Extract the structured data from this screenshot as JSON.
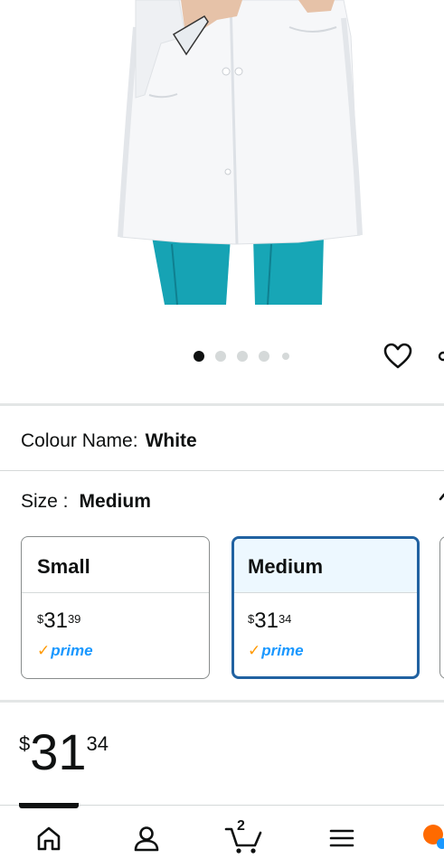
{
  "product": {
    "image_alt": "",
    "carousel": {
      "total": 5,
      "active_index": 0
    }
  },
  "colour": {
    "label": "Colour Name:",
    "value": "White"
  },
  "size": {
    "label": "Size :",
    "value": "Medium",
    "options": [
      {
        "name": "Small",
        "currency": "$",
        "whole": "31",
        "fraction": "39",
        "badge": "prime",
        "selected": false
      },
      {
        "name": "Medium",
        "currency": "$",
        "whole": "31",
        "fraction": "34",
        "badge": "prime",
        "selected": true
      }
    ]
  },
  "price": {
    "currency": "$",
    "whole": "31",
    "fraction": "34"
  },
  "bottom_nav": {
    "items": [
      {
        "name": "home",
        "icon": "home-icon",
        "active": true
      },
      {
        "name": "account",
        "icon": "user-icon",
        "active": false
      },
      {
        "name": "cart",
        "icon": "cart-icon",
        "count": "2",
        "active": false
      },
      {
        "name": "menu",
        "icon": "hamburger-menu-icon",
        "active": false
      },
      {
        "name": "rufus",
        "icon": "ai-assistant-icon",
        "active": false
      }
    ]
  },
  "colors": {
    "accent_selected": "#2162a1",
    "selected_bg": "#edf8ff",
    "prime_blue": "#1a98ff",
    "prime_check": "#ff9900",
    "scrub_teal": "#16a3b4"
  }
}
